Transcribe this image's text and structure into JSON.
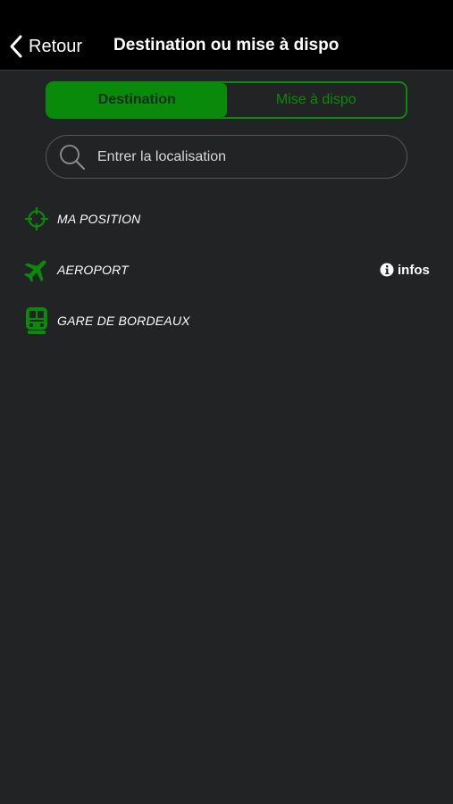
{
  "header": {
    "back_label": "Retour",
    "title": "Destination ou mise à dispo"
  },
  "segment": {
    "options": [
      "Destination",
      "Mise à dispo"
    ],
    "selected": "Destination"
  },
  "search": {
    "placeholder": "Entrer la localisation",
    "value": ""
  },
  "list": {
    "items": [
      {
        "label": "MA POSITION",
        "icon": "crosshair-icon"
      },
      {
        "label": "AEROPORT",
        "icon": "airplane-icon"
      },
      {
        "label": "GARE DE BORDEAUX",
        "icon": "train-icon"
      }
    ]
  },
  "infos": {
    "label": "infos",
    "icon": "info-icon"
  },
  "colors": {
    "accent": "#0a8a0a",
    "background": "#222324",
    "navbar": "#000000",
    "text": "#ffffff"
  }
}
